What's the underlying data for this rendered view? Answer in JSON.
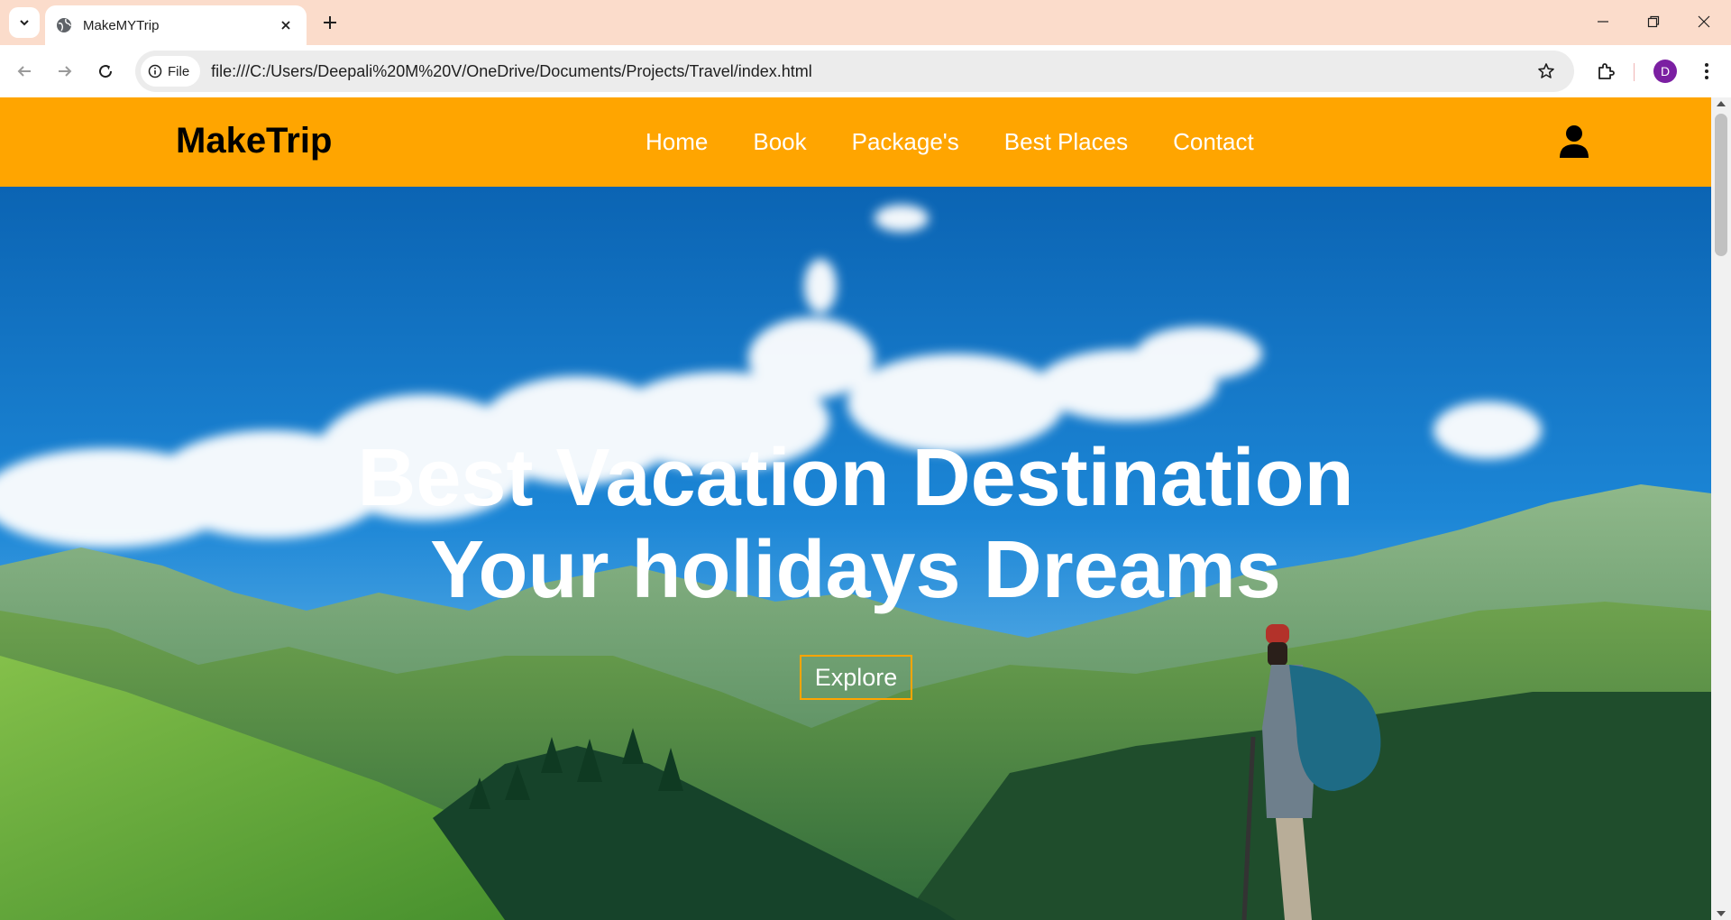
{
  "browser": {
    "tab_title": "MakeMYTrip",
    "url": "file:///C:/Users/Deepali%20M%20V/OneDrive/Documents/Projects/Travel/index.html",
    "site_info_label": "File",
    "profile_initial": "D",
    "tabbar_color": "#fbdccb"
  },
  "site": {
    "brand": "MakeTrip",
    "nav": [
      "Home",
      "Book",
      "Package's",
      "Best Places",
      "Contact"
    ],
    "header_color": "#ffa500"
  },
  "hero": {
    "title_line1": "Best Vacation Destination",
    "title_line2": "Your holidays Dreams",
    "cta": "Explore"
  }
}
